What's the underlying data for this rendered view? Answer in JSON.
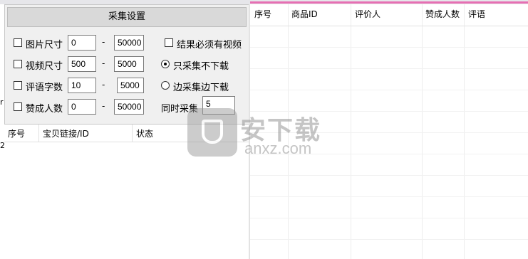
{
  "settings": {
    "title": "采集设置",
    "rows": [
      {
        "label": "图片尺寸",
        "min": "0",
        "max": "50000"
      },
      {
        "label": "视频尺寸",
        "min": "500",
        "max": "5000"
      },
      {
        "label": "评语字数",
        "min": "10",
        "max": "5000"
      },
      {
        "label": "赞成人数",
        "min": "0",
        "max": "50000"
      }
    ],
    "dash": "-",
    "must_have_video": "结果必须有视频",
    "collect_only": "只采集不下载",
    "collect_and_download": "边采集边下载",
    "concurrent_label": "同时采集",
    "concurrent_value": "5"
  },
  "left_list": {
    "columns": [
      "序号",
      "宝贝链接/ID",
      "状态"
    ]
  },
  "right_table": {
    "columns": [
      "序号",
      "商品ID",
      "评价人",
      "赞成人数",
      "评语"
    ]
  },
  "edge_marks": [
    "r",
    "2"
  ],
  "watermark": {
    "main": "安下载",
    "sub": "anxz.com"
  },
  "colors": {
    "accent_bar": "#e66fb3",
    "panel_bg": "#f0f0f0",
    "title_bg": "#d9d9d9"
  }
}
